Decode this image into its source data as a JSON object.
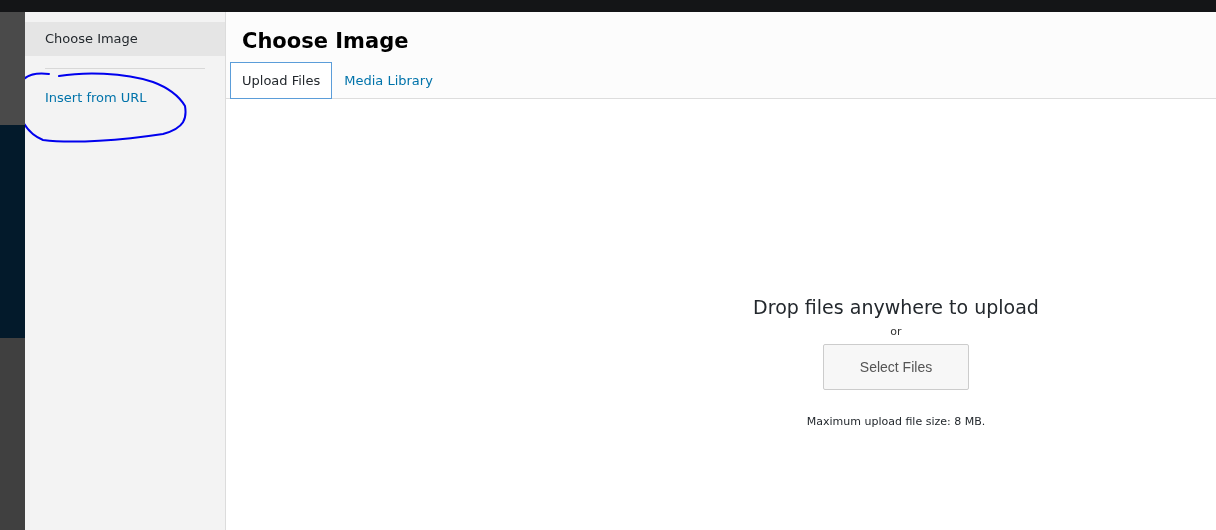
{
  "sidebar": {
    "groups": [
      {
        "items": [
          {
            "label": "Choose Image",
            "selected": true
          }
        ]
      },
      {
        "items": [
          {
            "label": "Insert from URL",
            "selected": false
          }
        ]
      }
    ]
  },
  "title": "Choose Image",
  "tabs": [
    {
      "label": "Upload Files",
      "selected": true
    },
    {
      "label": "Media Library",
      "selected": false
    }
  ],
  "uploader": {
    "heading": "Drop files anywhere to upload",
    "separator": "or",
    "button": "Select Files",
    "note": "Maximum upload file size: 8 MB."
  },
  "annotation": {
    "kind": "ellipse"
  }
}
